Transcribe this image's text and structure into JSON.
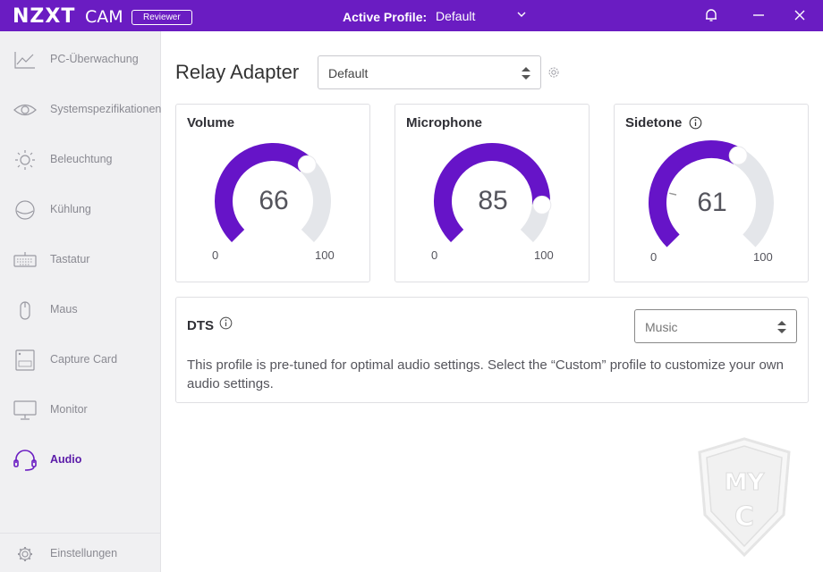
{
  "titlebar": {
    "logo": "NZXT",
    "app_name": "CAM",
    "badge": "Reviewer",
    "profile_label": "Active Profile:",
    "profile_value": "Default"
  },
  "sidebar": {
    "items": [
      {
        "label": "PC-Überwachung",
        "icon": "chart-line-icon"
      },
      {
        "label": "Systemspezifikationen",
        "icon": "eye-icon"
      },
      {
        "label": "Beleuchtung",
        "icon": "sun-icon"
      },
      {
        "label": "Kühlung",
        "icon": "cooler-icon"
      },
      {
        "label": "Tastatur",
        "icon": "keyboard-icon"
      },
      {
        "label": "Maus",
        "icon": "mouse-icon"
      },
      {
        "label": "Capture Card",
        "icon": "capture-card-icon"
      },
      {
        "label": "Monitor",
        "icon": "monitor-icon"
      },
      {
        "label": "Audio",
        "icon": "headset-icon",
        "active": true
      }
    ],
    "settings_label": "Einstellungen"
  },
  "main": {
    "device_name": "Relay Adapter",
    "profile_select": "Default",
    "gauges": [
      {
        "title": "Volume",
        "value": "66",
        "min": "0",
        "max": "100",
        "info": false
      },
      {
        "title": "Microphone",
        "value": "85",
        "min": "0",
        "max": "100",
        "info": false
      },
      {
        "title": "Sidetone",
        "value": "61",
        "min": "0",
        "max": "100",
        "info": true
      }
    ],
    "dts": {
      "title": "DTS",
      "select_value": "Music",
      "description": "This profile is pre-tuned for optimal audio settings. Select the “Custom” profile to customize your own audio settings."
    }
  },
  "watermark_text": "MYC",
  "colors": {
    "accent": "#6a1cc2",
    "gauge_fill": "#6614c8",
    "gauge_track": "#e4e6ea"
  }
}
